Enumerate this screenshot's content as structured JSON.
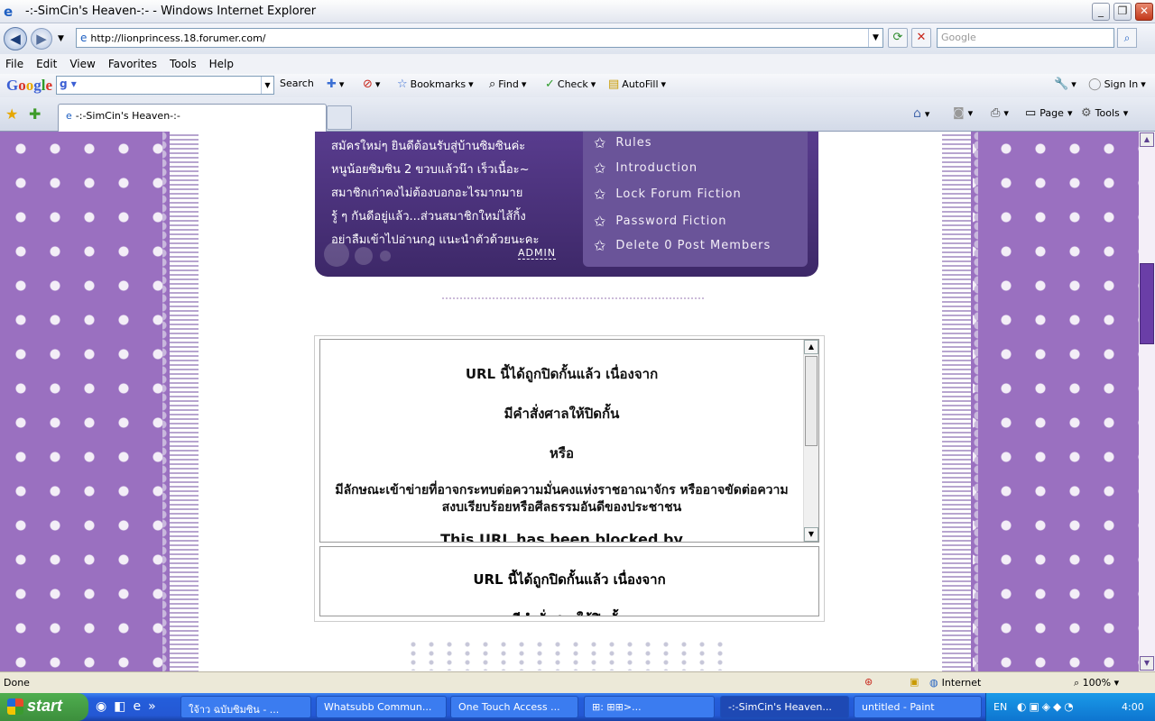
{
  "window": {
    "title": "-:-SimCin's Heaven-:- - Windows Internet Explorer"
  },
  "address": {
    "url": "http://lionprincess.18.forumer.com/",
    "search_placeholder": "Google"
  },
  "menu": [
    "File",
    "Edit",
    "View",
    "Favorites",
    "Tools",
    "Help"
  ],
  "google_toolbar": {
    "search_label": "Search",
    "bookmarks": "Bookmarks",
    "find": "Find",
    "check": "Check",
    "autofill": "AutoFill",
    "sign_in": "Sign In"
  },
  "tabs": [
    {
      "label": "-:-SimCin's Heaven-:-"
    }
  ],
  "command_bar": {
    "page": "Page",
    "tools": "Tools"
  },
  "banner": {
    "text_lines": [
      "สมัครใหม่ๆ ยินดีต้อนรับสู่บ้านซิมซินค่ะ",
      "หนูน้อยซิมซิน 2 ขวบแล้วน๊า เร็วเนื้อะ~",
      "สมาชิกเก่าคงไม่ต้องบอกอะไรมากมาย",
      "รู้ ๆ กันดีอยู่แล้ว...ส่วนสมาชิกใหม่ไส้กิ้ง",
      "อย่าลืมเข้าไปอ่านกฎ แนะนำตัวด้วยนะคะ"
    ],
    "admin": "ADMIN",
    "menu_items": [
      "Rules",
      "Introduction",
      "Lock Forum Fiction",
      "Password Fiction",
      "Delete 0 Post Members"
    ]
  },
  "blocked": {
    "title_th": "URL นี้ได้ถูกปิดกั้นแล้ว เนื่องจาก",
    "line2": "มีคำสั่งศาลให้ปิดกั้น",
    "or": "หรือ",
    "para": "มีลักษณะเข้าข่ายที่อาจกระทบต่อความมั่นคงแห่งราชอาณาจักร หรืออาจขัดต่อความสงบเรียบร้อยหรือศีลธรรมอันดีของประชาชน",
    "en": "This URL has been blocked by",
    "title_th_2": "URL นี้ได้ถูกปิดกั้นแล้ว เนื่องจาก",
    "line2_2": "มีคำสั่งศาลให้ปิดกั้น"
  },
  "status": {
    "text": "Done",
    "zone": "Internet",
    "zoom": "100%"
  },
  "taskbar": {
    "start": "start",
    "items": [
      "ใจ้าว ฉบับซิมซิน - ...",
      "Whatsubb Commun...",
      "One Touch Access ...",
      "⊞: ⊞⊞>...",
      "-:-SimCin's Heaven...",
      "untitled - Paint"
    ],
    "lang": "EN",
    "clock": "4:00"
  }
}
